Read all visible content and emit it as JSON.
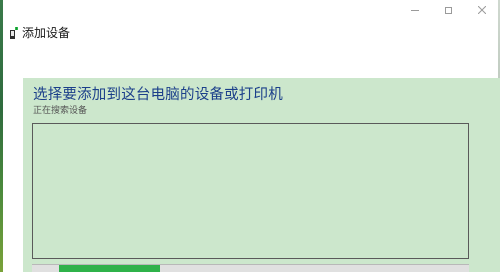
{
  "window": {
    "title": "添加设备",
    "icon": "add-device-icon",
    "controls": [
      "minimize-icon",
      "maximize-icon",
      "close-icon"
    ]
  },
  "main": {
    "heading": "选择要添加到这台电脑的设备或打印机",
    "status": "正在搜索设备",
    "device_list": [],
    "progress": {
      "state": "indeterminate",
      "fill_fraction": 0.23,
      "color": "#2fb24a"
    }
  },
  "colors": {
    "content_background": "#cce7cc",
    "heading": "#1b3f8a"
  }
}
